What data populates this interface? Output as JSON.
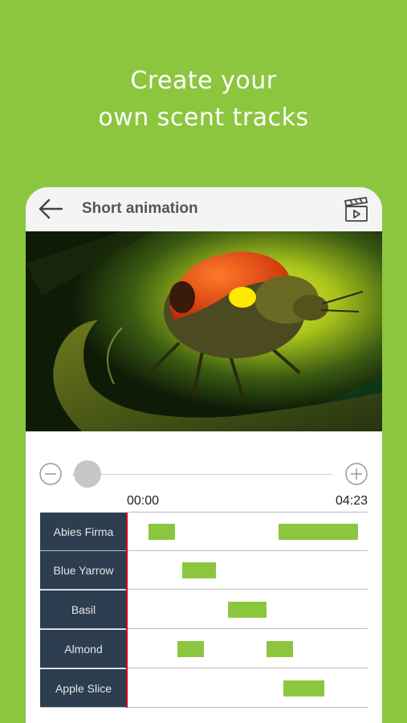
{
  "headline": {
    "line1": "Create your",
    "line2": "own scent tracks"
  },
  "appbar": {
    "title": "Short animation",
    "back_icon": "arrow-left-icon",
    "action_icon": "clapperboard-icon"
  },
  "player": {
    "time_start": "00:00",
    "time_end": "04:23",
    "scrub_position": 0.0
  },
  "colors": {
    "brand_green": "#8cc63f",
    "label_bg": "#2c3e50",
    "playhead": "#d0021b"
  },
  "tracks": [
    {
      "label": "Abies Firma",
      "segments": [
        {
          "start": 0.09,
          "end": 0.2
        },
        {
          "start": 0.63,
          "end": 0.96
        }
      ]
    },
    {
      "label": "Blue Yarrow",
      "segments": [
        {
          "start": 0.23,
          "end": 0.37
        }
      ]
    },
    {
      "label": "Basil",
      "segments": [
        {
          "start": 0.42,
          "end": 0.58
        }
      ]
    },
    {
      "label": "Almond",
      "segments": [
        {
          "start": 0.21,
          "end": 0.32
        },
        {
          "start": 0.58,
          "end": 0.69
        }
      ]
    },
    {
      "label": "Apple Slice",
      "segments": [
        {
          "start": 0.65,
          "end": 0.82
        }
      ]
    }
  ]
}
